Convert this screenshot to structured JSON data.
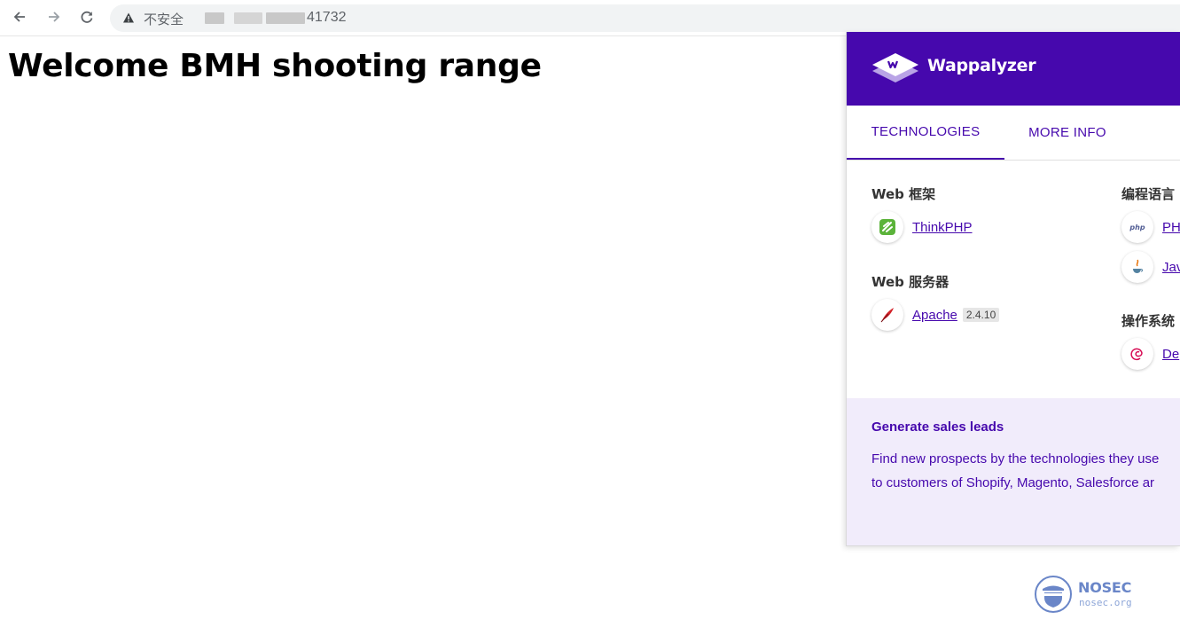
{
  "browser": {
    "security_label": "不安全",
    "address_visible": "41732",
    "icons": {
      "back": "arrow-left-icon",
      "forward": "arrow-right-icon",
      "reload": "reload-icon",
      "security": "warning-triangle-icon"
    }
  },
  "page": {
    "heading": "Welcome BMH shooting range"
  },
  "wappalyzer": {
    "brand": "Wappalyzer",
    "brand_color": "#4608ad",
    "tabs": [
      {
        "label": "TECHNOLOGIES",
        "active": true
      },
      {
        "label": "MORE INFO",
        "active": false
      }
    ],
    "categories": {
      "web_framework": {
        "title": "Web 框架",
        "items": [
          {
            "name": "ThinkPHP",
            "icon": "thinkphp-icon"
          }
        ]
      },
      "web_server": {
        "title": "Web 服务器",
        "items": [
          {
            "name": "Apache",
            "version": "2.4.10",
            "icon": "apache-feather-icon"
          }
        ]
      },
      "language": {
        "title": "编程语言",
        "items": [
          {
            "name": "PH",
            "icon": "php-icon"
          },
          {
            "name": "Jav",
            "icon": "java-icon"
          }
        ]
      },
      "os": {
        "title": "操作系统",
        "items": [
          {
            "name": "De",
            "icon": "debian-icon"
          }
        ]
      }
    },
    "leads": {
      "title": "Generate sales leads",
      "line1": "Find new prospects by the technologies they use",
      "line2": "to customers of Shopify, Magento, Salesforce ar"
    }
  },
  "watermark": {
    "name": "NOSEC",
    "domain": "nosec.org"
  }
}
